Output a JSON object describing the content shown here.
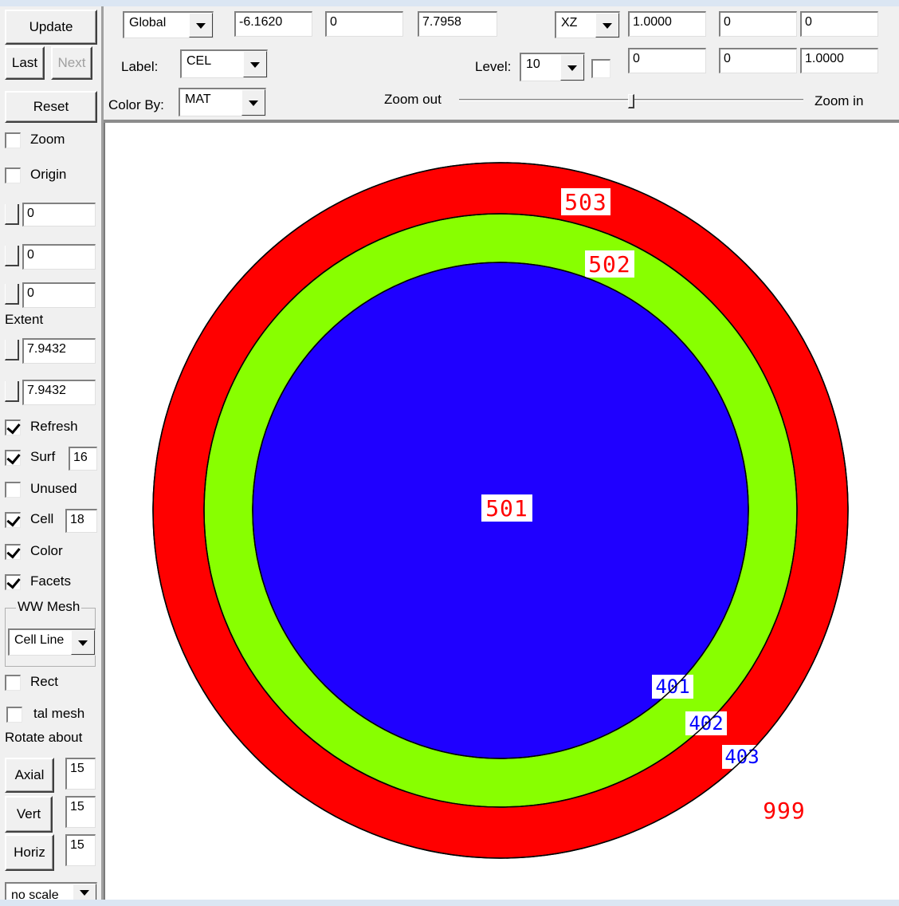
{
  "sidebar": {
    "update_label": "Update",
    "last_label": "Last",
    "next_label": "Next",
    "reset_label": "Reset",
    "zoom_label": "Zoom",
    "origin_label": "Origin",
    "origin_values": [
      "0",
      "0",
      "0"
    ],
    "extent_label": "Extent",
    "extent_values": [
      "7.9432",
      "7.9432"
    ],
    "refresh_label": "Refresh",
    "surf_label": "Surf",
    "surf_value": "16",
    "unused_label": "Unused",
    "cell_label": "Cell",
    "cell_value": "18",
    "color_label": "Color",
    "facets_label": "Facets",
    "ww_mesh_title": "WW Mesh",
    "ww_mesh_option": "Cell Line",
    "rect_label": "Rect",
    "tal_mesh_label": "tal mesh",
    "rotate_about_label": "Rotate about",
    "axial_label": "Axial",
    "axial_value": "15",
    "vert_label": "Vert",
    "vert_value": "15",
    "horiz_label": "Horiz",
    "horiz_value": "15",
    "scale_option": "no scale"
  },
  "toolbar": {
    "frame_option": "Global",
    "origin": [
      "-6.1620",
      "0",
      "7.7958"
    ],
    "plane_option": "XZ",
    "basis_row1": [
      "1.0000",
      "0",
      "0"
    ],
    "basis_row2": [
      "0",
      "0",
      "1.0000"
    ],
    "label_label": "Label:",
    "label_option": "CEL",
    "level_label": "Level:",
    "level_option": "10",
    "color_by_label": "Color By:",
    "color_by_option": "MAT",
    "zoom_out_label": "Zoom out",
    "zoom_in_label": "Zoom in"
  },
  "plot": {
    "cell_labels": {
      "outer": "503",
      "middle": "502",
      "inner": "501",
      "outside": "999"
    },
    "surface_labels": [
      "401",
      "402",
      "403"
    ],
    "colors": {
      "outer": "#ff0000",
      "middle": "#88ff00",
      "inner": "#1f00ff",
      "cell_label_text": "#ff0000",
      "surface_label_text": "#0000ff"
    }
  }
}
